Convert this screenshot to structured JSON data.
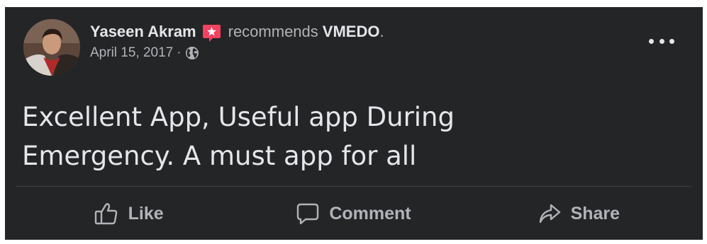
{
  "post": {
    "author": "Yaseen Akram",
    "verb": "recommends",
    "page_name": "VMEDO",
    "end_punct": ".",
    "date": "April 15, 2017",
    "separator": "·",
    "audience_icon": "globe-icon",
    "recommend_icon": "recommendation-star-icon",
    "text_line1": "Excellent App, Useful app During",
    "text_line2": "Emergency. A must app for all"
  },
  "actions": {
    "like_label": "Like",
    "comment_label": "Comment",
    "share_label": "Share"
  },
  "colors": {
    "card_bg": "#242526",
    "primary_text": "#e4e6eb",
    "secondary_text": "#b0b3b8",
    "recommend_badge": "#f3425f",
    "divider": "#3e4042"
  }
}
